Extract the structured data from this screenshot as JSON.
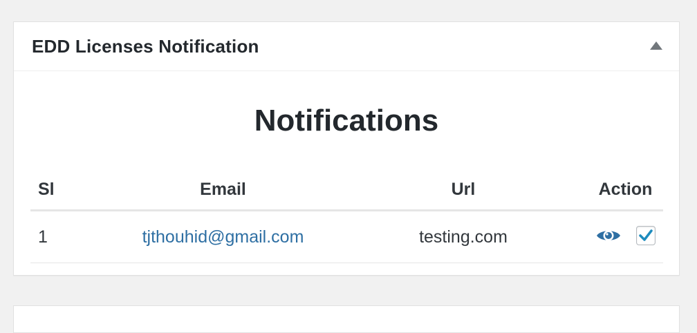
{
  "panel": {
    "title": "EDD Licenses Notification",
    "section_title": "Notifications"
  },
  "table": {
    "headers": {
      "sl": "Sl",
      "email": "Email",
      "url": "Url",
      "action": "Action"
    },
    "rows": [
      {
        "sl": "1",
        "email": "tjthouhid@gmail.com",
        "url": "testing.com",
        "actions": {
          "view_icon": "eye-icon",
          "check_icon": "checkbox-checked-icon",
          "checked": true
        }
      }
    ]
  },
  "colors": {
    "link": "#2e6fa3",
    "icon_blue": "#2e6fa3",
    "check_blue": "#1e8cbe"
  }
}
